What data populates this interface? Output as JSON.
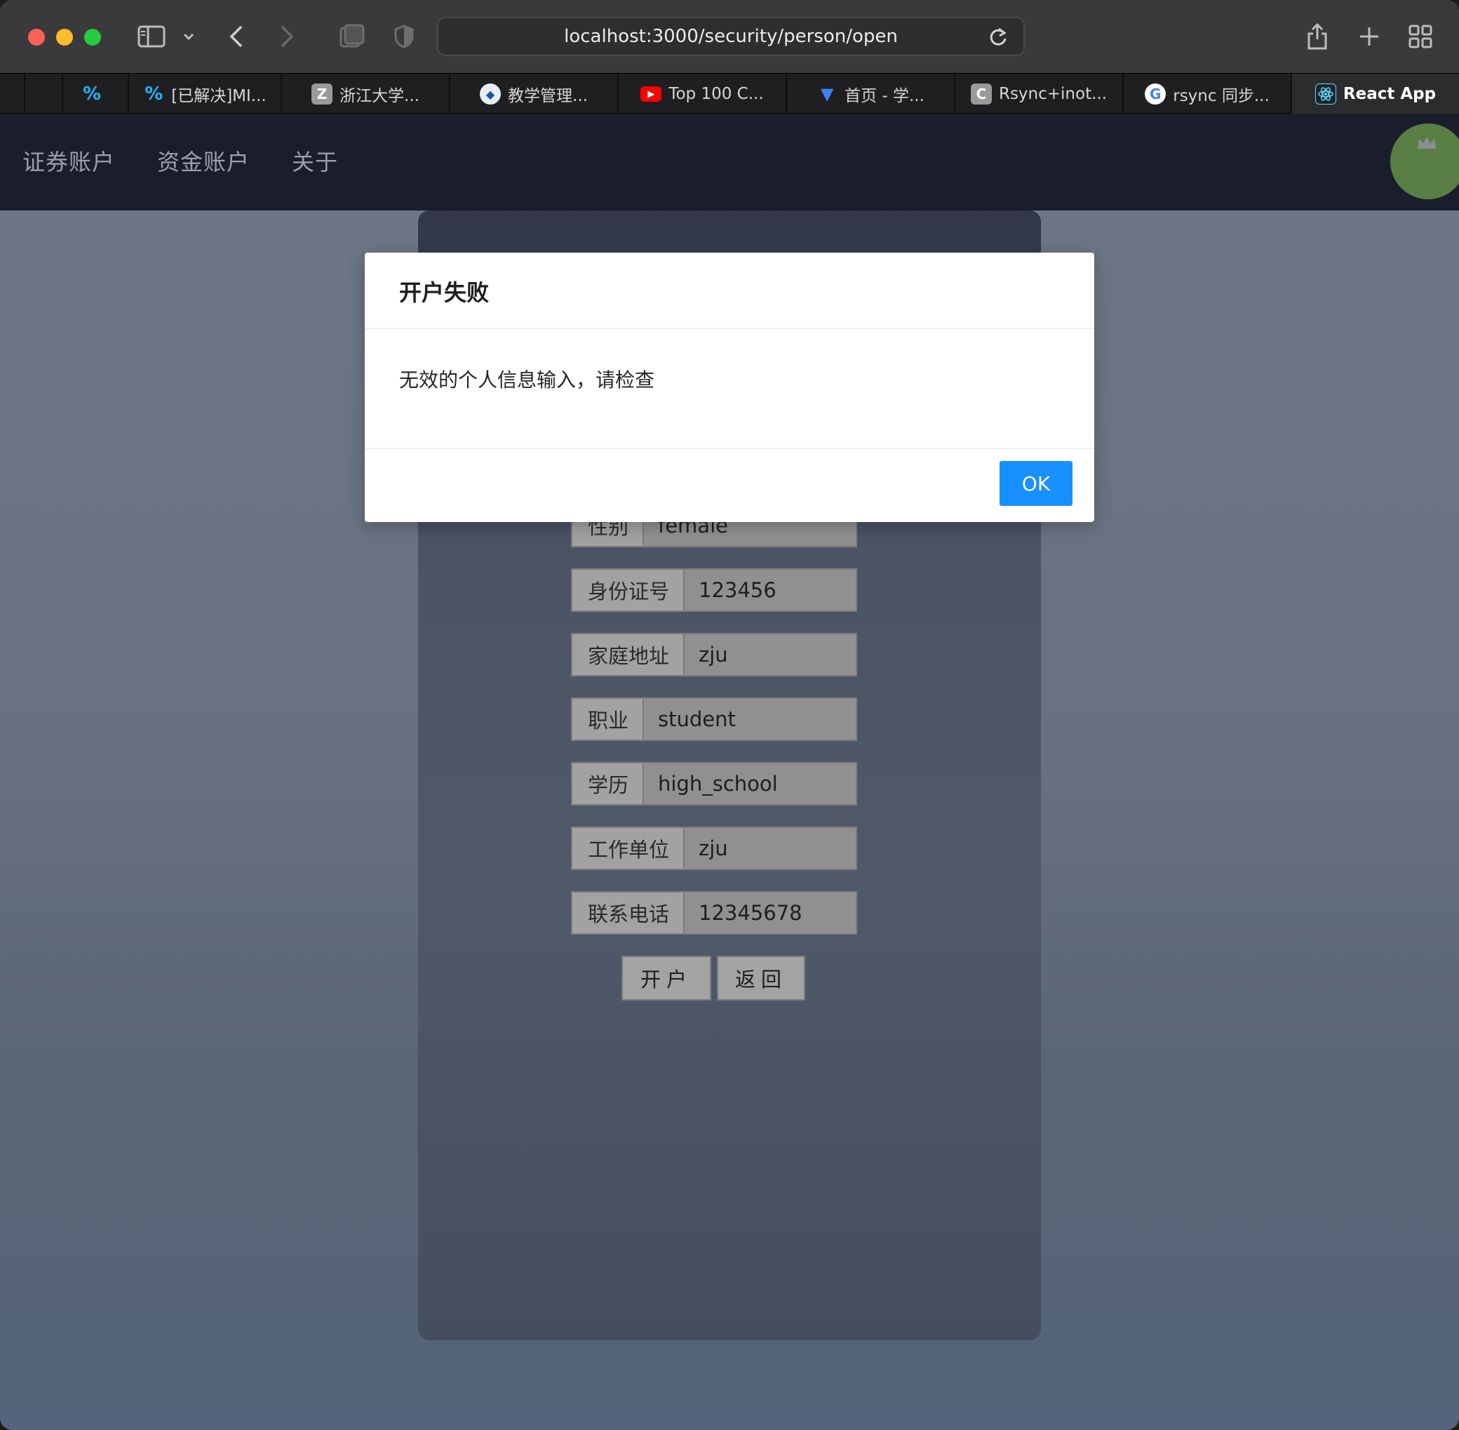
{
  "browser": {
    "url": "localhost:3000/security/person/open",
    "tabs": [
      {
        "label": "",
        "icon": "gitee-icon"
      },
      {
        "label": "[已解决]MI...",
        "icon": "gitee-icon"
      },
      {
        "label": "浙江大学...",
        "icon": "z-letter-icon"
      },
      {
        "label": "教学管理...",
        "icon": "zju-logo-icon"
      },
      {
        "label": "Top 100 C...",
        "icon": "youtube-icon"
      },
      {
        "label": "首页 - 学...",
        "icon": "vue-icon"
      },
      {
        "label": "Rsync+inot...",
        "icon": "c-letter-icon"
      },
      {
        "label": "rsync 同步...",
        "icon": "google-icon"
      },
      {
        "label": "React App",
        "icon": "react-icon"
      }
    ]
  },
  "nav": {
    "items": [
      "证券账户",
      "资金账户",
      "关于"
    ]
  },
  "form": {
    "fields": [
      {
        "label": "性别",
        "value": "female"
      },
      {
        "label": "身份证号",
        "value": "123456"
      },
      {
        "label": "家庭地址",
        "value": "zju"
      },
      {
        "label": "职业",
        "value": "student"
      },
      {
        "label": "学历",
        "value": "high_school"
      },
      {
        "label": "工作单位",
        "value": "zju"
      },
      {
        "label": "联系电话",
        "value": "12345678"
      }
    ],
    "open_button": "开户",
    "back_button": "返回"
  },
  "modal": {
    "title": "开户失败",
    "message": "无效的个人信息输入，请检查",
    "ok_label": "OK"
  },
  "colors": {
    "primary": "#1890ff",
    "navbar": "#1a1e2c",
    "avatar": "#5a7f45"
  }
}
